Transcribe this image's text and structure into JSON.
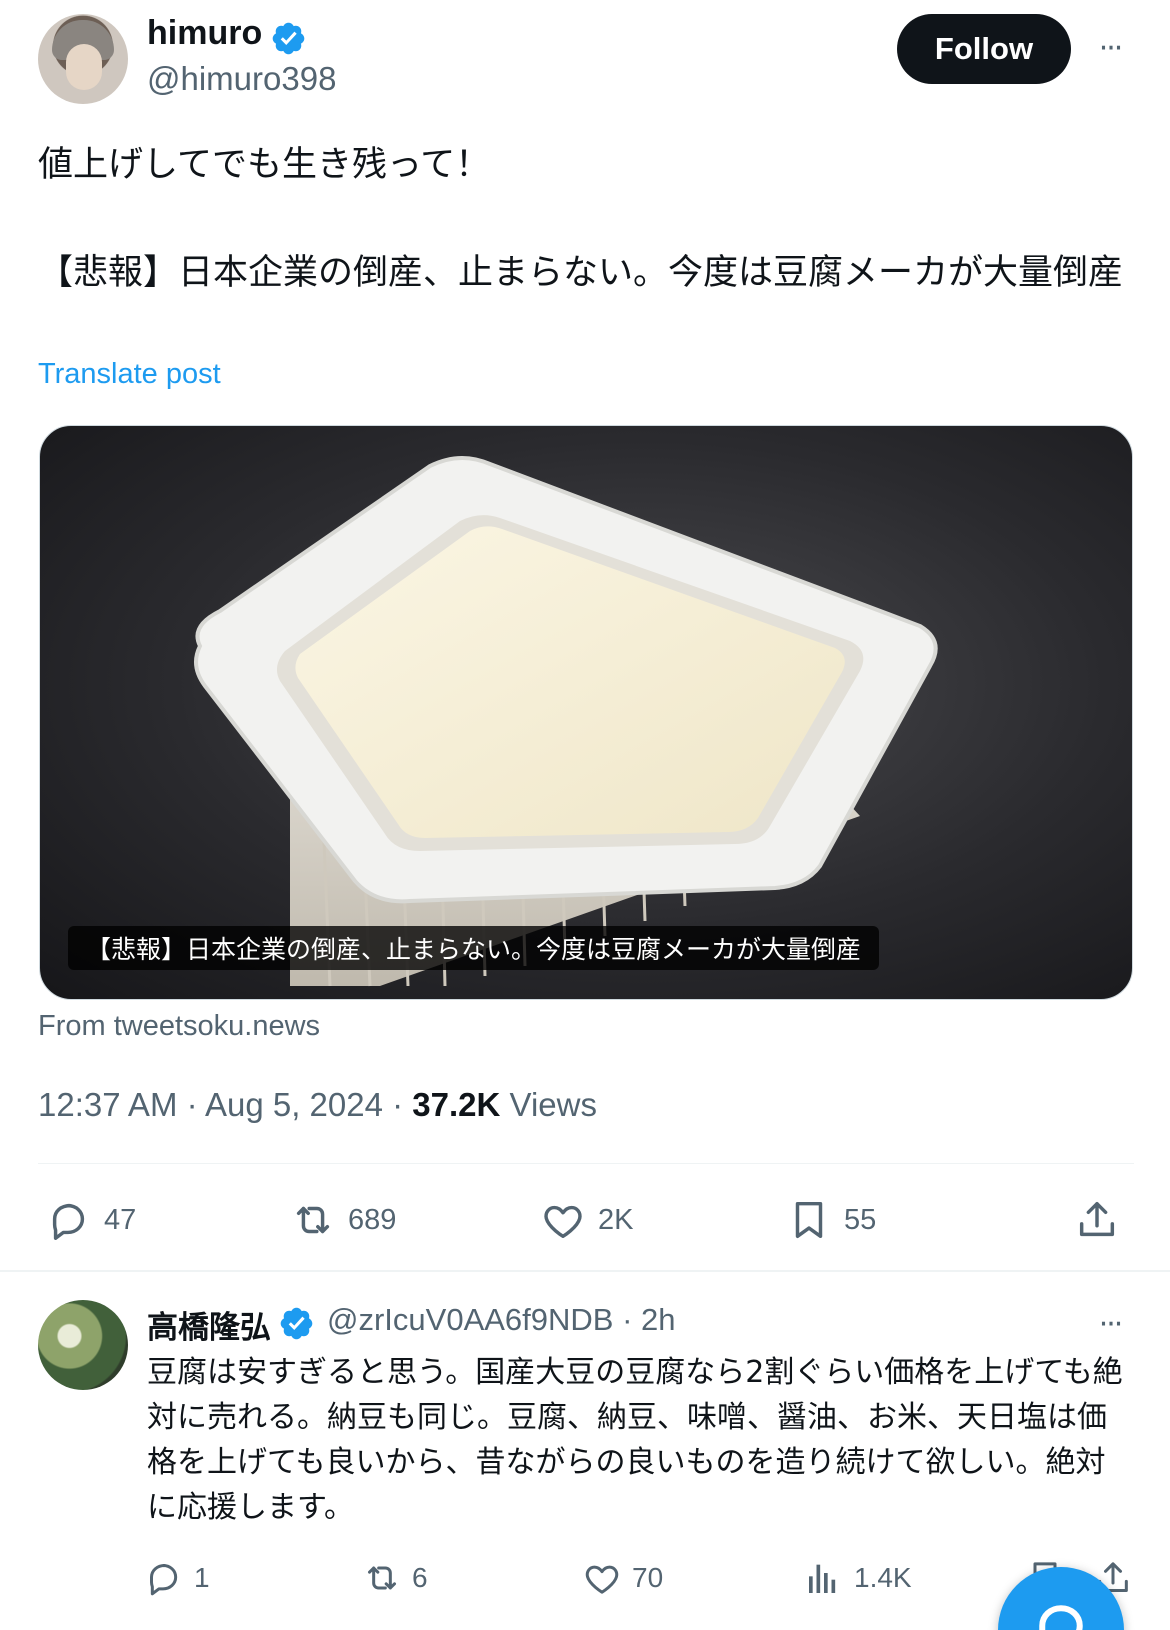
{
  "post": {
    "author_name": "himuro",
    "author_handle": "@himuro398",
    "follow_label": "Follow",
    "more_label": "···",
    "text_line1": "値上げしてでも生き残って！",
    "text_line2": "【悲報】日本企業の倒産、止まらない。今度は豆腐メーカが大量倒産",
    "translate_label": "Translate post",
    "media_caption": "【悲報】日本企業の倒産、止まらない。今度は豆腐メーカが大量倒産",
    "link_source": "From tweetsoku.news",
    "time": "12:37 AM",
    "date": "Aug 5, 2024",
    "views_count": "37.2K",
    "views_label": "Views",
    "replies": "47",
    "reposts": "689",
    "likes": "2K",
    "bookmarks": "55"
  },
  "reply": {
    "author_name": "高橋隆弘",
    "author_handle": "@zrIcuV0AA6f9NDB · 2h",
    "more_label": "···",
    "text": "豆腐は安すぎると思う。国産大豆の豆腐なら2割ぐらい価格を上げても絶対に売れる。納豆も同じ。豆腐、納豆、味噌、醤油、お米、天日塩は価格を上げても良いから、昔ながらの良いものを造り続けて欲しい。絶対に応援します。",
    "replies": "1",
    "reposts": "6",
    "likes": "70",
    "views": "1.4K"
  },
  "icons": {
    "verified": "verified-badge-icon",
    "reply": "reply-icon",
    "repost": "repost-icon",
    "like": "heart-icon",
    "bookmark": "bookmark-icon",
    "share": "share-icon",
    "views": "views-icon",
    "compose": "compose-icon"
  },
  "colors": {
    "accent": "#1d9bf0",
    "text": "#0f1419",
    "muted": "#536471",
    "follow_bg": "#0f1419"
  }
}
